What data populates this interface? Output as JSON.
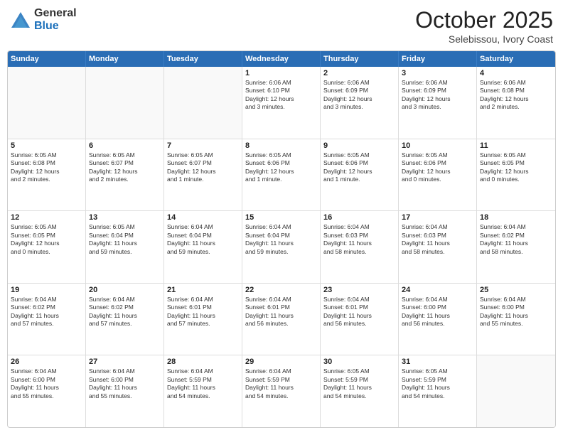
{
  "header": {
    "logo_general": "General",
    "logo_blue": "Blue",
    "month_title": "October 2025",
    "location": "Selebissou, Ivory Coast"
  },
  "weekdays": [
    "Sunday",
    "Monday",
    "Tuesday",
    "Wednesday",
    "Thursday",
    "Friday",
    "Saturday"
  ],
  "rows": [
    [
      {
        "day": "",
        "info": "",
        "empty": true
      },
      {
        "day": "",
        "info": "",
        "empty": true
      },
      {
        "day": "",
        "info": "",
        "empty": true
      },
      {
        "day": "1",
        "info": "Sunrise: 6:06 AM\nSunset: 6:10 PM\nDaylight: 12 hours\nand 3 minutes.",
        "empty": false
      },
      {
        "day": "2",
        "info": "Sunrise: 6:06 AM\nSunset: 6:09 PM\nDaylight: 12 hours\nand 3 minutes.",
        "empty": false
      },
      {
        "day": "3",
        "info": "Sunrise: 6:06 AM\nSunset: 6:09 PM\nDaylight: 12 hours\nand 3 minutes.",
        "empty": false
      },
      {
        "day": "4",
        "info": "Sunrise: 6:06 AM\nSunset: 6:08 PM\nDaylight: 12 hours\nand 2 minutes.",
        "empty": false
      }
    ],
    [
      {
        "day": "5",
        "info": "Sunrise: 6:05 AM\nSunset: 6:08 PM\nDaylight: 12 hours\nand 2 minutes.",
        "empty": false
      },
      {
        "day": "6",
        "info": "Sunrise: 6:05 AM\nSunset: 6:07 PM\nDaylight: 12 hours\nand 2 minutes.",
        "empty": false
      },
      {
        "day": "7",
        "info": "Sunrise: 6:05 AM\nSunset: 6:07 PM\nDaylight: 12 hours\nand 1 minute.",
        "empty": false
      },
      {
        "day": "8",
        "info": "Sunrise: 6:05 AM\nSunset: 6:06 PM\nDaylight: 12 hours\nand 1 minute.",
        "empty": false
      },
      {
        "day": "9",
        "info": "Sunrise: 6:05 AM\nSunset: 6:06 PM\nDaylight: 12 hours\nand 1 minute.",
        "empty": false
      },
      {
        "day": "10",
        "info": "Sunrise: 6:05 AM\nSunset: 6:06 PM\nDaylight: 12 hours\nand 0 minutes.",
        "empty": false
      },
      {
        "day": "11",
        "info": "Sunrise: 6:05 AM\nSunset: 6:05 PM\nDaylight: 12 hours\nand 0 minutes.",
        "empty": false
      }
    ],
    [
      {
        "day": "12",
        "info": "Sunrise: 6:05 AM\nSunset: 6:05 PM\nDaylight: 12 hours\nand 0 minutes.",
        "empty": false
      },
      {
        "day": "13",
        "info": "Sunrise: 6:05 AM\nSunset: 6:04 PM\nDaylight: 11 hours\nand 59 minutes.",
        "empty": false
      },
      {
        "day": "14",
        "info": "Sunrise: 6:04 AM\nSunset: 6:04 PM\nDaylight: 11 hours\nand 59 minutes.",
        "empty": false
      },
      {
        "day": "15",
        "info": "Sunrise: 6:04 AM\nSunset: 6:04 PM\nDaylight: 11 hours\nand 59 minutes.",
        "empty": false
      },
      {
        "day": "16",
        "info": "Sunrise: 6:04 AM\nSunset: 6:03 PM\nDaylight: 11 hours\nand 58 minutes.",
        "empty": false
      },
      {
        "day": "17",
        "info": "Sunrise: 6:04 AM\nSunset: 6:03 PM\nDaylight: 11 hours\nand 58 minutes.",
        "empty": false
      },
      {
        "day": "18",
        "info": "Sunrise: 6:04 AM\nSunset: 6:02 PM\nDaylight: 11 hours\nand 58 minutes.",
        "empty": false
      }
    ],
    [
      {
        "day": "19",
        "info": "Sunrise: 6:04 AM\nSunset: 6:02 PM\nDaylight: 11 hours\nand 57 minutes.",
        "empty": false
      },
      {
        "day": "20",
        "info": "Sunrise: 6:04 AM\nSunset: 6:02 PM\nDaylight: 11 hours\nand 57 minutes.",
        "empty": false
      },
      {
        "day": "21",
        "info": "Sunrise: 6:04 AM\nSunset: 6:01 PM\nDaylight: 11 hours\nand 57 minutes.",
        "empty": false
      },
      {
        "day": "22",
        "info": "Sunrise: 6:04 AM\nSunset: 6:01 PM\nDaylight: 11 hours\nand 56 minutes.",
        "empty": false
      },
      {
        "day": "23",
        "info": "Sunrise: 6:04 AM\nSunset: 6:01 PM\nDaylight: 11 hours\nand 56 minutes.",
        "empty": false
      },
      {
        "day": "24",
        "info": "Sunrise: 6:04 AM\nSunset: 6:00 PM\nDaylight: 11 hours\nand 56 minutes.",
        "empty": false
      },
      {
        "day": "25",
        "info": "Sunrise: 6:04 AM\nSunset: 6:00 PM\nDaylight: 11 hours\nand 55 minutes.",
        "empty": false
      }
    ],
    [
      {
        "day": "26",
        "info": "Sunrise: 6:04 AM\nSunset: 6:00 PM\nDaylight: 11 hours\nand 55 minutes.",
        "empty": false
      },
      {
        "day": "27",
        "info": "Sunrise: 6:04 AM\nSunset: 6:00 PM\nDaylight: 11 hours\nand 55 minutes.",
        "empty": false
      },
      {
        "day": "28",
        "info": "Sunrise: 6:04 AM\nSunset: 5:59 PM\nDaylight: 11 hours\nand 54 minutes.",
        "empty": false
      },
      {
        "day": "29",
        "info": "Sunrise: 6:04 AM\nSunset: 5:59 PM\nDaylight: 11 hours\nand 54 minutes.",
        "empty": false
      },
      {
        "day": "30",
        "info": "Sunrise: 6:05 AM\nSunset: 5:59 PM\nDaylight: 11 hours\nand 54 minutes.",
        "empty": false
      },
      {
        "day": "31",
        "info": "Sunrise: 6:05 AM\nSunset: 5:59 PM\nDaylight: 11 hours\nand 54 minutes.",
        "empty": false
      },
      {
        "day": "",
        "info": "",
        "empty": true
      }
    ]
  ]
}
